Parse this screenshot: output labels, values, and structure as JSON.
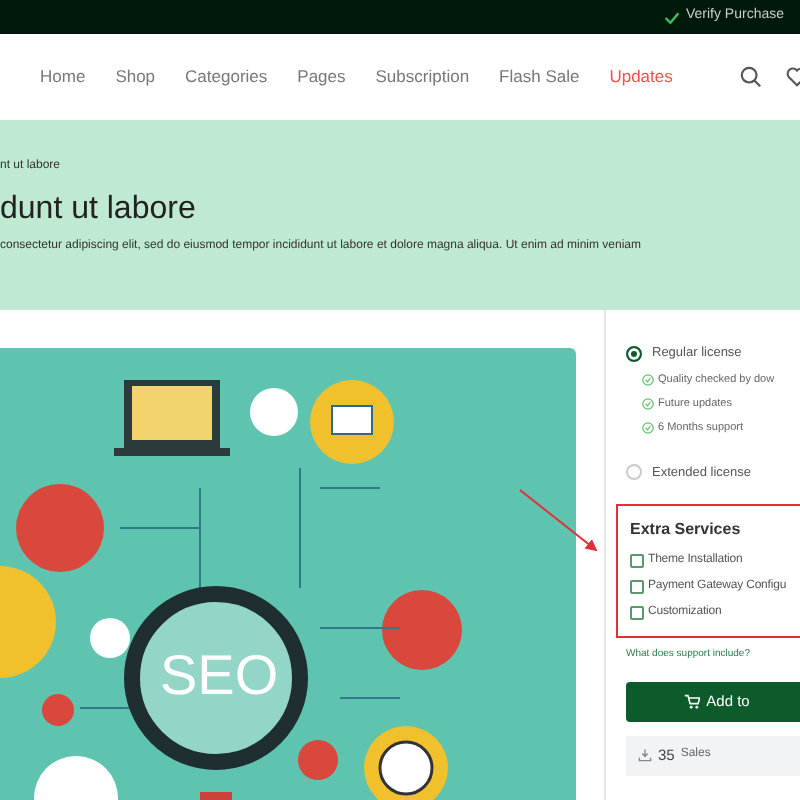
{
  "top_bar": {
    "link": "Verify Purchase"
  },
  "nav": {
    "items": [
      {
        "label": "Home",
        "selected": false
      },
      {
        "label": "Shop",
        "selected": false
      },
      {
        "label": "Categories",
        "selected": false
      },
      {
        "label": "Pages",
        "selected": false
      },
      {
        "label": "Subscription",
        "selected": false
      },
      {
        "label": "Flash Sale",
        "selected": false
      },
      {
        "label": "Updates",
        "selected": true
      }
    ]
  },
  "hero": {
    "breadcrumb": "nt ut labore",
    "title": "dunt ut labore",
    "description": "consectetur adipiscing elit, sed do eiusmod tempor incididunt ut labore et dolore magna aliqua. Ut enim ad minim veniam"
  },
  "illustration": {
    "label": "SEO"
  },
  "licenses": [
    {
      "label": "Regular license",
      "selected": true,
      "features": [
        "Quality checked by dow",
        "Future updates",
        "6 Months support"
      ]
    },
    {
      "label": "Extended license",
      "selected": false
    }
  ],
  "extra_services": {
    "title": "Extra Services",
    "items": [
      {
        "label": "Theme Installation",
        "checked": false
      },
      {
        "label": "Payment Gateway Configu",
        "checked": false
      },
      {
        "label": "Customization",
        "checked": false
      }
    ]
  },
  "support_link": "What does support include?",
  "add_button": "Add to",
  "sales": {
    "count": "35",
    "label": "Sales"
  }
}
